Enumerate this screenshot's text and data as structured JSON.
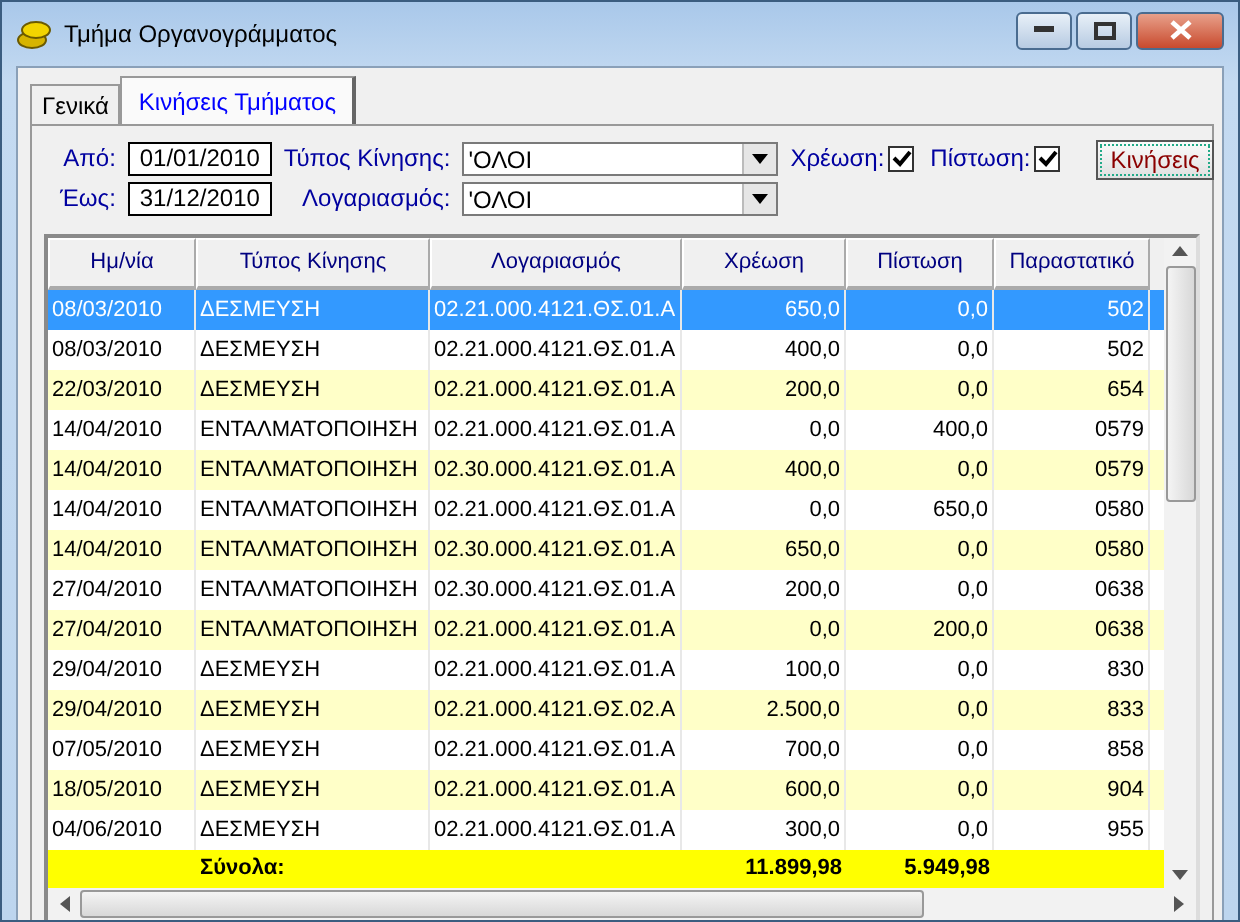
{
  "window": {
    "title": "Τμήμα Οργανογράμματος"
  },
  "tabs": [
    {
      "label": "Γενικά",
      "selected": false
    },
    {
      "label": "Κινήσεις Τμήματος",
      "selected": true
    }
  ],
  "filters": {
    "from_label": "Από:",
    "from_value": "01/01/2010",
    "to_label": "Έως:",
    "to_value": "31/12/2010",
    "movement_type_label": "Τύπος Κίνησης:",
    "movement_type_value": "'ΟΛΟΙ",
    "account_label": "Λογαριασμός:",
    "account_value": "'ΟΛΟΙ",
    "debit_label": "Χρέωση:",
    "debit_checked": true,
    "credit_label": "Πίστωση:",
    "credit_checked": true,
    "button": "Κινήσεις"
  },
  "table": {
    "columns": [
      "Ημ/νία",
      "Τύπος Κίνησης",
      "Λογαριασμός",
      "Χρέωση",
      "Πίστωση",
      "Παραστατικό"
    ],
    "rows": [
      {
        "selected": true,
        "cells": [
          "08/03/2010",
          "ΔΕΣΜΕΥΣΗ",
          "02.21.000.4121.ΘΣ.01.Α",
          "650,0",
          "0,0",
          "502"
        ]
      },
      {
        "selected": false,
        "cells": [
          "08/03/2010",
          "ΔΕΣΜΕΥΣΗ",
          "02.21.000.4121.ΘΣ.01.Α",
          "400,0",
          "0,0",
          "502"
        ]
      },
      {
        "selected": false,
        "cells": [
          "22/03/2010",
          "ΔΕΣΜΕΥΣΗ",
          "02.21.000.4121.ΘΣ.01.Α",
          "200,0",
          "0,0",
          "654"
        ]
      },
      {
        "selected": false,
        "cells": [
          "14/04/2010",
          "ΕΝΤΑΛΜΑΤΟΠΟΙΗΣΗ",
          "02.21.000.4121.ΘΣ.01.Α",
          "0,0",
          "400,0",
          "0579"
        ]
      },
      {
        "selected": false,
        "cells": [
          "14/04/2010",
          "ΕΝΤΑΛΜΑΤΟΠΟΙΗΣΗ",
          "02.30.000.4121.ΘΣ.01.Α",
          "400,0",
          "0,0",
          "0579"
        ]
      },
      {
        "selected": false,
        "cells": [
          "14/04/2010",
          "ΕΝΤΑΛΜΑΤΟΠΟΙΗΣΗ",
          "02.21.000.4121.ΘΣ.01.Α",
          "0,0",
          "650,0",
          "0580"
        ]
      },
      {
        "selected": false,
        "cells": [
          "14/04/2010",
          "ΕΝΤΑΛΜΑΤΟΠΟΙΗΣΗ",
          "02.30.000.4121.ΘΣ.01.Α",
          "650,0",
          "0,0",
          "0580"
        ]
      },
      {
        "selected": false,
        "cells": [
          "27/04/2010",
          "ΕΝΤΑΛΜΑΤΟΠΟΙΗΣΗ",
          "02.30.000.4121.ΘΣ.01.Α",
          "200,0",
          "0,0",
          "0638"
        ]
      },
      {
        "selected": false,
        "cells": [
          "27/04/2010",
          "ΕΝΤΑΛΜΑΤΟΠΟΙΗΣΗ",
          "02.21.000.4121.ΘΣ.01.Α",
          "0,0",
          "200,0",
          "0638"
        ]
      },
      {
        "selected": false,
        "cells": [
          "29/04/2010",
          "ΔΕΣΜΕΥΣΗ",
          "02.21.000.4121.ΘΣ.01.Α",
          "100,0",
          "0,0",
          "830"
        ]
      },
      {
        "selected": false,
        "cells": [
          "29/04/2010",
          "ΔΕΣΜΕΥΣΗ",
          "02.21.000.4121.ΘΣ.02.Α",
          "2.500,0",
          "0,0",
          "833"
        ]
      },
      {
        "selected": false,
        "cells": [
          "07/05/2010",
          "ΔΕΣΜΕΥΣΗ",
          "02.21.000.4121.ΘΣ.01.Α",
          "700,0",
          "0,0",
          "858"
        ]
      },
      {
        "selected": false,
        "cells": [
          "18/05/2010",
          "ΔΕΣΜΕΥΣΗ",
          "02.21.000.4121.ΘΣ.01.Α",
          "600,0",
          "0,0",
          "904"
        ]
      },
      {
        "selected": false,
        "cells": [
          "04/06/2010",
          "ΔΕΣΜΕΥΣΗ",
          "02.21.000.4121.ΘΣ.01.Α",
          "300,0",
          "0,0",
          "955"
        ]
      }
    ],
    "totals": {
      "label": "Σύνολα:",
      "debit": "11.899,98",
      "credit": "5.949,98"
    }
  }
}
